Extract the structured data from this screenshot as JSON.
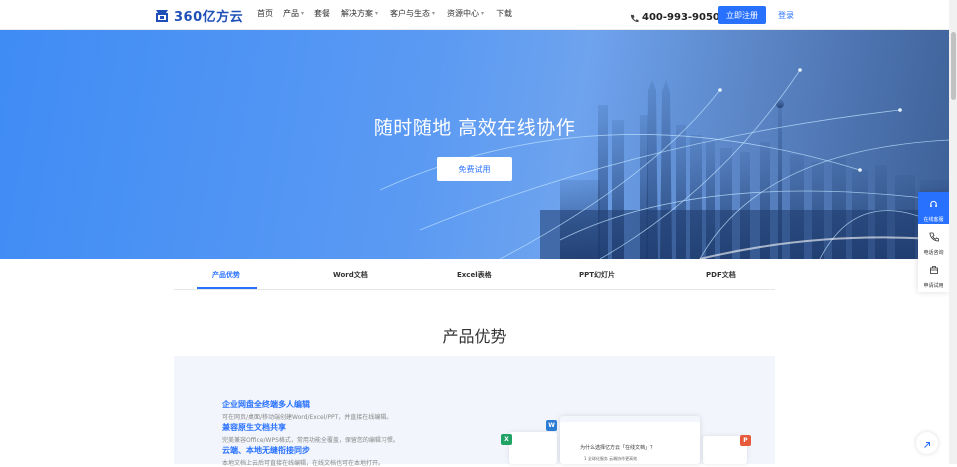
{
  "brand": {
    "name": "360亿方云",
    "color": "#1e4fb8"
  },
  "nav": {
    "items": [
      {
        "label": "首页",
        "dropdown": false
      },
      {
        "label": "产品",
        "dropdown": true
      },
      {
        "label": "套餐",
        "dropdown": false
      },
      {
        "label": "解决方案",
        "dropdown": true
      },
      {
        "label": "客户与生态",
        "dropdown": true
      },
      {
        "label": "资源中心",
        "dropdown": true
      },
      {
        "label": "下载",
        "dropdown": false
      }
    ],
    "phone": "400-993-9050",
    "register_label": "立即注册",
    "login_label": "登录"
  },
  "hero": {
    "title": "随时随地 高效在线协作",
    "cta_label": "免费试用"
  },
  "tabs": {
    "items": [
      "产品优势",
      "Word文档",
      "Excel表格",
      "PPT幻灯片",
      "PDF文档"
    ],
    "active_index": 0
  },
  "section": {
    "title": "产品优势",
    "features": [
      {
        "title": "企业网盘全终端多人编辑",
        "desc": "可在网页/桌面/移动端创建Word/Excel/PPT，并直接在线编辑。"
      },
      {
        "title": "兼容原生文档共享",
        "desc": "完美兼容Office/WPS格式，常用功能全覆盖，保留您的编辑习惯。"
      },
      {
        "title": "云端、本地无缝衔接同步",
        "desc": "本地文档上云后可直接在线编辑，在线文档也可在本地打开。"
      }
    ],
    "mock": {
      "doc_title": "为什么选择亿方云「在线文档」？",
      "doc_line": "1  全球化服务   云端协作更高效",
      "badges": [
        "X",
        "W",
        "P"
      ]
    }
  },
  "side_bar": {
    "items": [
      {
        "label": "在线客服",
        "icon": "headset-icon",
        "active": true
      },
      {
        "label": "电话咨询",
        "icon": "phone-icon",
        "active": false
      },
      {
        "label": "申请试用",
        "icon": "trial-icon",
        "active": false
      }
    ],
    "back_top_icon": "arrow-up-icon"
  },
  "colors": {
    "accent": "#2871ff",
    "excel": "#21a366",
    "word": "#2b7cd3",
    "ppt": "#e55b3c"
  }
}
